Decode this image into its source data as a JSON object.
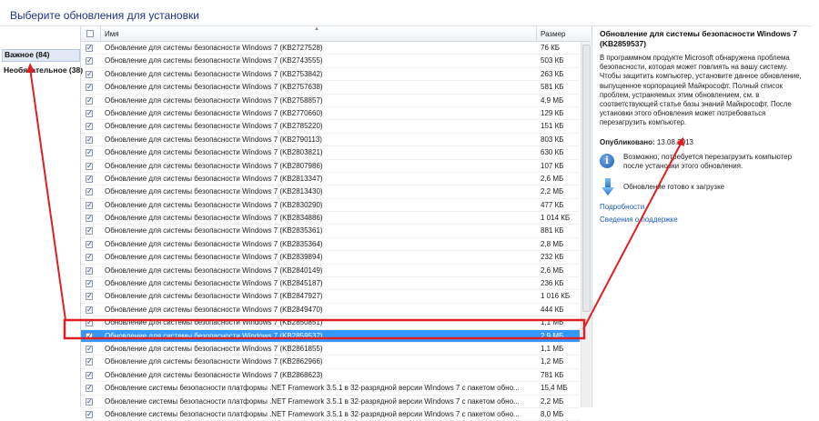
{
  "header": {
    "title": "Выберите обновления для установки"
  },
  "sidebar": {
    "categories": [
      {
        "label": "Важное (84)"
      },
      {
        "label": "Необязательное (38)"
      }
    ]
  },
  "list": {
    "columns": {
      "name": "Имя",
      "size": "Размер"
    },
    "rows": [
      {
        "name": "Обновление для системы безопасности Windows 7 (KB2727528)",
        "size": "76 КБ"
      },
      {
        "name": "Обновление для системы безопасности Windows 7 (KB2743555)",
        "size": "503 КБ"
      },
      {
        "name": "Обновление для системы безопасности Windows 7 (KB2753842)",
        "size": "263 КБ"
      },
      {
        "name": "Обновление для системы безопасности Windows 7 (KB2757638)",
        "size": "581 КБ"
      },
      {
        "name": "Обновление для системы безопасности Windows 7 (KB2758857)",
        "size": "4,9 МБ"
      },
      {
        "name": "Обновление для системы безопасности Windows 7 (KB2770660)",
        "size": "129 КБ"
      },
      {
        "name": "Обновление для системы безопасности Windows 7 (KB2785220)",
        "size": "151 КБ"
      },
      {
        "name": "Обновление для системы безопасности Windows 7 (KB2790113)",
        "size": "803 КБ"
      },
      {
        "name": "Обновление для системы безопасности Windows 7 (KB2803821)",
        "size": "630 КБ"
      },
      {
        "name": "Обновление для системы безопасности Windows 7 (KB2807986)",
        "size": "107 КБ"
      },
      {
        "name": "Обновление для системы безопасности Windows 7 (KB2813347)",
        "size": "2,6 МБ"
      },
      {
        "name": "Обновление для системы безопасности Windows 7 (KB2813430)",
        "size": "2,2 МБ"
      },
      {
        "name": "Обновление для системы безопасности Windows 7 (KB2830290)",
        "size": "477 КБ"
      },
      {
        "name": "Обновление для системы безопасности Windows 7 (KB2834886)",
        "size": "1 014 КБ"
      },
      {
        "name": "Обновление для системы безопасности Windows 7 (KB2835361)",
        "size": "881 КБ"
      },
      {
        "name": "Обновление для системы безопасности Windows 7 (KB2835364)",
        "size": "2,8 МБ"
      },
      {
        "name": "Обновление для системы безопасности Windows 7 (KB2839894)",
        "size": "232 КБ"
      },
      {
        "name": "Обновление для системы безопасности Windows 7 (KB2840149)",
        "size": "2,6 МБ"
      },
      {
        "name": "Обновление для системы безопасности Windows 7 (KB2845187)",
        "size": "236 КБ"
      },
      {
        "name": "Обновление для системы безопасности Windows 7 (KB2847927)",
        "size": "1 016 КБ"
      },
      {
        "name": "Обновление для системы безопасности Windows 7 (KB2849470)",
        "size": "444 КБ"
      },
      {
        "name": "Обновление для системы безопасности Windows 7 (KB2850851)",
        "size": "1,1 МБ"
      },
      {
        "name": "Обновление для системы безопасности Windows 7 (KB2859537)",
        "size": "2,9 МБ"
      },
      {
        "name": "Обновление для системы безопасности Windows 7 (KB2861855)",
        "size": "1,1 МБ"
      },
      {
        "name": "Обновление для системы безопасности Windows 7 (KB2862966)",
        "size": "1,2 МБ"
      },
      {
        "name": "Обновление для системы безопасности Windows 7 (KB2868623)",
        "size": "781 КБ"
      },
      {
        "name": "Обновление системы безопасности платформы .NET Framework 3.5.1 в 32-разрядной версии Windows 7 с пакетом обно...",
        "size": "15,4 МБ"
      },
      {
        "name": "Обновление системы безопасности платформы .NET Framework 3.5.1 в 32-разрядной версии Windows 7 с пакетом обно...",
        "size": "2,2 МБ"
      },
      {
        "name": "Обновление системы безопасности платформы .NET Framework 3.5.1 в 32-разрядной версии Windows 7 с пакетом обно...",
        "size": "8,0 МБ"
      }
    ]
  },
  "details": {
    "title": "Обновление для системы безопасности Windows 7 (KB2859537)",
    "description": "В программном продукте Microsoft обнаружена проблема безопасности, которая может повлиять на вашу систему. Чтобы защитить компьютер, установите данное обновление, выпущенное корпорацией Майкрософт. Полный список проблем, устраняемых этим обновлением, см. в соответствующей статье базы знаний Майкрософт. После установки этого обновления может потребоваться перезагрузить компьютер.",
    "published_label": "Опубликовано:",
    "published_date": "13.08.2013",
    "restart_note": "Возможно, потребуется перезагрузить компьютер после установки этого обновления.",
    "ready_status": "Обновление готово к загрузке",
    "more_link": "Подробности",
    "support_link": "Сведения о поддержке"
  },
  "colors": {
    "accent": "#3399ff",
    "annotation": "#e02020",
    "link": "#1a5dbe"
  },
  "icons": [
    "info-icon",
    "download-arrow-icon",
    "checkbox-checked-icon"
  ]
}
